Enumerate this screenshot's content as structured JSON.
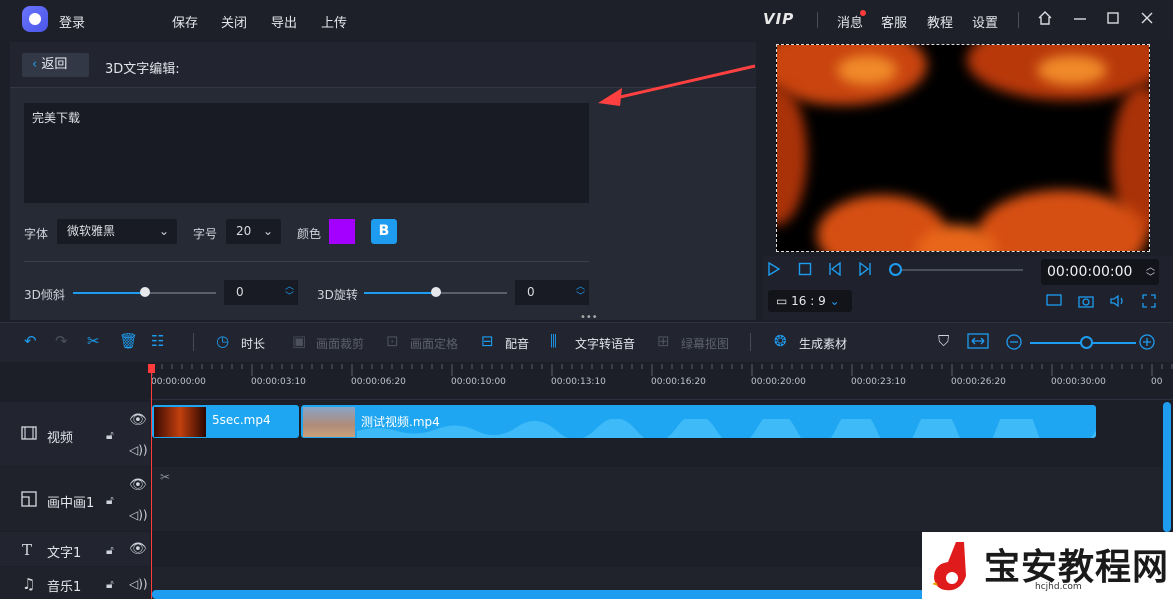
{
  "titlebar": {
    "login": "登录",
    "menu": [
      "保存",
      "关闭",
      "导出",
      "上传"
    ],
    "vip": "VIP",
    "right_menu": [
      "消息",
      "客服",
      "教程",
      "设置"
    ]
  },
  "panel": {
    "back_label": "返回",
    "title": "3D文字编辑:",
    "text_value": "完美下载",
    "font_label": "字体",
    "font_value": "微软雅黑",
    "size_label": "字号",
    "size_value": "20",
    "color_label": "颜色",
    "color_value": "#a400ff",
    "bold_label": "B",
    "tilt_label": "3D倾斜",
    "tilt_value": "0",
    "rotate_label": "3D旋转",
    "rotate_value": "0"
  },
  "player": {
    "time": "00:00:00:00",
    "ratio": "16 : 9"
  },
  "toolbar": {
    "duration": "时长",
    "crop": "画面裁剪",
    "freeze": "画面定格",
    "dub": "配音",
    "tts": "文字转语音",
    "chroma": "绿幕抠图",
    "generate": "生成素材"
  },
  "ruler": {
    "ticks": [
      "00:00:00:00",
      "00:00:03:10",
      "00:00:06:20",
      "00:00:10:00",
      "00:00:13:10",
      "00:00:16:20",
      "00:00:20:00",
      "00:00:23:10",
      "00:00:26:20",
      "00:00:30:00",
      "00"
    ]
  },
  "tracks": {
    "video": "视频",
    "pip": "画中画1",
    "text": "文字1",
    "music": "音乐1"
  },
  "clips": {
    "clip1": "5sec.mp4",
    "clip2": "测试视频.mp4"
  },
  "watermark": {
    "title": "宝安教程网",
    "url": "hcjhd.com"
  },
  "colors": {
    "accent": "#1e9cf0",
    "bg": "#1c1f28",
    "panel": "#262a35"
  }
}
